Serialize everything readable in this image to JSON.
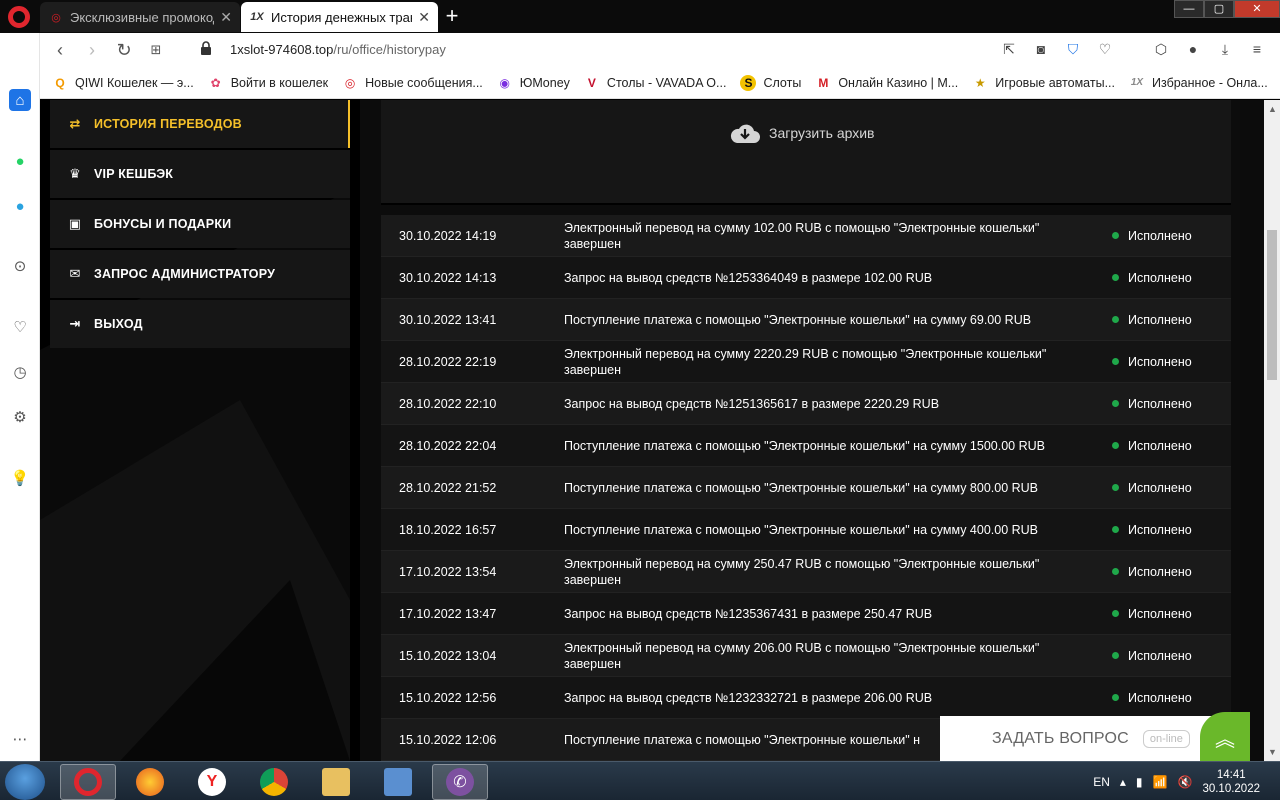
{
  "browser": {
    "tabs": [
      {
        "title": "Эксклюзивные промокоды",
        "icon": "opera-red-icon",
        "active": false
      },
      {
        "title": "История денежных транзакций",
        "icon": "1x-icon",
        "active": true
      }
    ],
    "url_domain": "1xslot-974608.top",
    "url_path": "/ru/office/historypay",
    "bookmarks": [
      {
        "label": "QIWI Кошелек — э...",
        "icon": "qiwi-icon",
        "color": "#f39a00",
        "glyph": "Q"
      },
      {
        "label": "Войти в кошелек",
        "icon": "flower-icon",
        "color": "#e0426a",
        "glyph": "✿"
      },
      {
        "label": "Новые сообщения...",
        "icon": "opera-red-icon",
        "color": "#d81c25",
        "glyph": "◎"
      },
      {
        "label": "ЮMoney",
        "icon": "yoomoney-icon",
        "color": "#7b2ee0",
        "glyph": "◉"
      },
      {
        "label": "Столы - VAVADA O...",
        "icon": "vavada-icon",
        "color": "#c4122f",
        "glyph": "V"
      },
      {
        "label": "Слоты",
        "icon": "slots-icon",
        "color": "#f2c200",
        "glyph": "S"
      },
      {
        "label": "Онлайн Казино | M...",
        "icon": "m-icon",
        "color": "#d41f26",
        "glyph": "M"
      },
      {
        "label": "Игровые автоматы...",
        "icon": "star-icon",
        "color": "#444",
        "glyph": "★"
      },
      {
        "label": "Избранное - Онла...",
        "icon": "1x-icon",
        "color": "#888",
        "glyph": "1X"
      }
    ]
  },
  "menu": {
    "items": [
      {
        "label": "ИСТОРИЯ ПЕРЕВОДОВ",
        "icon": "transfer-arrows-icon",
        "glyph": "⇄",
        "active": true
      },
      {
        "label": "VIP КЕШБЭК",
        "icon": "crown-icon",
        "glyph": "♛",
        "active": false
      },
      {
        "label": "БОНУСЫ И ПОДАРКИ",
        "icon": "gift-icon",
        "glyph": "🎁",
        "active": false
      },
      {
        "label": "ЗАПРОС АДМИНИСТРАТОРУ",
        "icon": "envelope-icon",
        "glyph": "✉",
        "active": false
      },
      {
        "label": "ВЫХОД",
        "icon": "logout-icon",
        "glyph": "⇥",
        "active": false
      }
    ]
  },
  "archive": {
    "label": "Загрузить архив"
  },
  "history": {
    "rows": [
      {
        "date": "30.10.2022 14:19",
        "desc": "Электронный перевод на сумму 102.00 RUB с помощью \"Электронные кошельки\" завершен",
        "status": "Исполнено"
      },
      {
        "date": "30.10.2022 14:13",
        "desc": "Запрос на вывод средств №1253364049 в размере 102.00 RUB",
        "status": "Исполнено"
      },
      {
        "date": "30.10.2022 13:41",
        "desc": "Поступление платежа с помощью \"Электронные кошельки\" на сумму 69.00 RUB",
        "status": "Исполнено"
      },
      {
        "date": "28.10.2022 22:19",
        "desc": "Электронный перевод на сумму 2220.29 RUB с помощью \"Электронные кошельки\" завершен",
        "status": "Исполнено"
      },
      {
        "date": "28.10.2022 22:10",
        "desc": "Запрос на вывод средств №1251365617 в размере 2220.29 RUB",
        "status": "Исполнено"
      },
      {
        "date": "28.10.2022 22:04",
        "desc": "Поступление платежа с помощью \"Электронные кошельки\" на сумму 1500.00 RUB",
        "status": "Исполнено"
      },
      {
        "date": "28.10.2022 21:52",
        "desc": "Поступление платежа с помощью \"Электронные кошельки\" на сумму 800.00 RUB",
        "status": "Исполнено"
      },
      {
        "date": "18.10.2022 16:57",
        "desc": "Поступление платежа с помощью \"Электронные кошельки\" на сумму 400.00 RUB",
        "status": "Исполнено"
      },
      {
        "date": "17.10.2022 13:54",
        "desc": "Электронный перевод на сумму 250.47 RUB с помощью \"Электронные кошельки\" завершен",
        "status": "Исполнено"
      },
      {
        "date": "17.10.2022 13:47",
        "desc": "Запрос на вывод средств №1235367431 в размере 250.47 RUB",
        "status": "Исполнено"
      },
      {
        "date": "15.10.2022 13:04",
        "desc": "Электронный перевод на сумму 206.00 RUB с помощью \"Электронные кошельки\" завершен",
        "status": "Исполнено"
      },
      {
        "date": "15.10.2022 12:56",
        "desc": "Запрос на вывод средств №1232332721 в размере 206.00 RUB",
        "status": "Исполнено"
      },
      {
        "date": "15.10.2022 12:06",
        "desc": "Поступление платежа с помощью \"Электронные кошельки\" н",
        "status": ""
      }
    ]
  },
  "chat": {
    "label": "ЗАДАТЬ ВОПРОС",
    "online": "on-line"
  },
  "taskbar": {
    "language": "EN",
    "time": "14:41",
    "date": "30.10.2022"
  },
  "colors": {
    "accent": "#f5c02a",
    "status_ok": "#1fa84a",
    "chat_green": "#6ab82a"
  }
}
